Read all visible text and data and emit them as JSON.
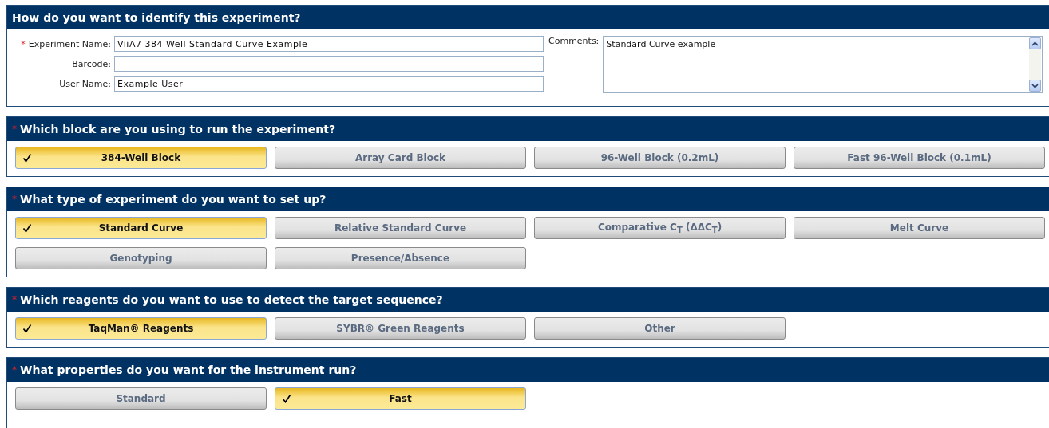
{
  "identify": {
    "title": "How do you want to identify this experiment?",
    "fields": [
      {
        "label": "Experiment Name:",
        "required_mark": "*",
        "value": "ViiA7 384-Well Standard Curve Example"
      },
      {
        "label": "Barcode:"
      },
      {
        "label": "User Name:",
        "value": "Example User"
      }
    ],
    "comments": {
      "label": "Comments:",
      "value": "Standard Curve example"
    }
  },
  "sections": [
    {
      "title": "Which block are you using to run the experiment?",
      "required_mark": "*",
      "options": [
        {
          "label": "384-Well Block",
          "selected": true
        },
        {
          "label": "Array Card Block",
          "selected": false
        },
        {
          "label": "96-Well Block (0.2mL)",
          "selected": false
        },
        {
          "label": "Fast 96-Well Block (0.1mL)",
          "selected": false
        }
      ]
    },
    {
      "title": "What type of experiment do you want to set up?",
      "required_mark": "*",
      "options": [
        {
          "label": "Standard Curve",
          "selected": true
        },
        {
          "label": "Relative Standard Curve",
          "selected": false
        },
        {
          "label": "Comparative C$_{T}$ (ΔΔC$_{T}$)",
          "selected": false
        },
        {
          "label": "Melt Curve",
          "selected": false
        },
        {
          "label": "Genotyping",
          "selected": false
        },
        {
          "label": "Presence/Absence",
          "selected": false
        }
      ]
    },
    {
      "title": "Which reagents do you want to use to detect the target sequence?",
      "required_mark": "*",
      "options": [
        {
          "label": "TaqMan® Reagents",
          "selected": true
        },
        {
          "label": "SYBR® Green Reagents",
          "selected": false
        },
        {
          "label": "Other",
          "selected": false
        }
      ]
    },
    {
      "title": "What properties do you want for the instrument run?",
      "required_mark": "*",
      "options": [
        {
          "label": "Standard",
          "selected": false
        },
        {
          "label": "Fast",
          "selected": true
        }
      ]
    }
  ]
}
